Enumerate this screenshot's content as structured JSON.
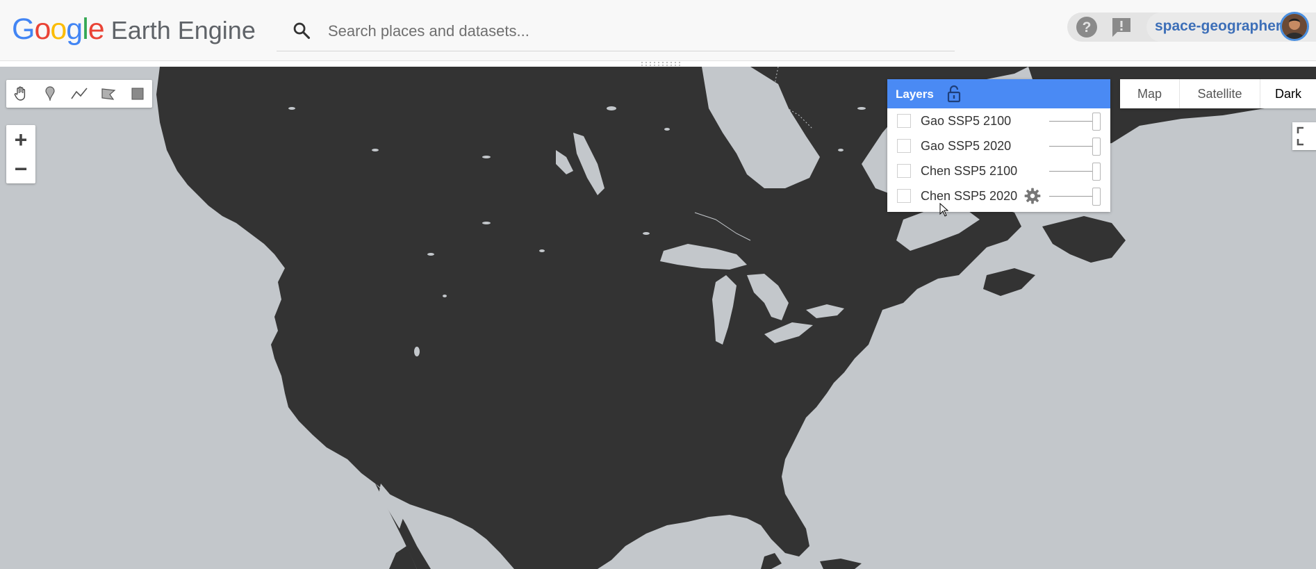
{
  "app": {
    "logo_google": [
      "G",
      "o",
      "o",
      "g",
      "l",
      "e"
    ],
    "logo_colors": [
      "#4285f4",
      "#ea4335",
      "#fbbc05",
      "#4285f4",
      "#34a853",
      "#ea4335"
    ],
    "logo_product": "Earth Engine"
  },
  "search": {
    "icon": "search-icon",
    "placeholder": "Search places and datasets..."
  },
  "account": {
    "help_icon": "help-icon",
    "feedback_icon": "feedback-icon",
    "username": "space-geographer",
    "accent": "#3d6fb8"
  },
  "draw_tools": [
    {
      "name": "pan-hand-icon",
      "label": "Pan"
    },
    {
      "name": "marker-icon",
      "label": "Add a marker"
    },
    {
      "name": "line-icon",
      "label": "Draw a line"
    },
    {
      "name": "polygon-icon",
      "label": "Draw a shape"
    },
    {
      "name": "rectangle-icon",
      "label": "Draw a rectangle"
    }
  ],
  "zoom": {
    "in": "+",
    "out": "−"
  },
  "layers": {
    "title": "Layers",
    "header_color": "#4a8af4",
    "lock_icon": "unlock-icon",
    "items": [
      {
        "label": "Gao SSP5 2100",
        "checked": false,
        "opacity": 1.0
      },
      {
        "label": "Gao SSP5 2020",
        "checked": false,
        "opacity": 1.0
      },
      {
        "label": "Chen SSP5 2100",
        "checked": false,
        "opacity": 1.0
      },
      {
        "label": "Chen SSP5 2020",
        "checked": false,
        "opacity": 1.0,
        "hovered": true
      }
    ]
  },
  "map_type": {
    "options": [
      "Map",
      "Satellite",
      "Dark"
    ],
    "selected": "Dark"
  },
  "map": {
    "water_color": "#c3c7cb",
    "land_color": "#333333"
  }
}
